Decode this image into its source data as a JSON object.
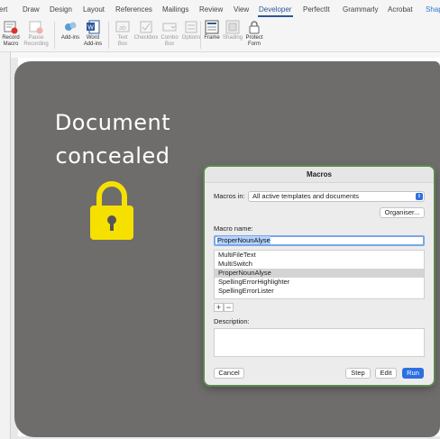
{
  "ribbon_tabs": [
    "ert",
    "Draw",
    "Design",
    "Layout",
    "References",
    "Mailings",
    "Review",
    "View",
    "Developer",
    "PerfectIt",
    "Grammarly",
    "Acrobat",
    "Shap"
  ],
  "active_tab": "Developer",
  "toolbar": {
    "record_macro": "Record\nMacro",
    "pause_recording": "Pause\nRecording",
    "add_ins": "Add-ins",
    "word_add_ins": "Word\nAdd-ins",
    "text_box": "Text\nBox",
    "checkbox": "Checkbox",
    "combo_box": "Combo\nBox",
    "options": "Options",
    "frame": "Frame",
    "shading": "Shading",
    "protect_form": "Protect\nForm"
  },
  "document": {
    "overlay_line1": "Document",
    "overlay_line2": "concealed",
    "icon": "padlock-icon",
    "lock_color": "#f5e000",
    "overlay_color": "#6f6c6c"
  },
  "macros_dialog": {
    "title": "Macros",
    "macros_in_label": "Macros in:",
    "macros_in_value": "All active templates and documents",
    "organiser_button": "Organiser...",
    "macro_name_label": "Macro name:",
    "macro_name_value": "ProperNounAlyse",
    "macro_list": [
      "MultiFileText",
      "MultiSwitch",
      "ProperNounAlyse",
      "SpellingErrorHighlighter",
      "SpellingErrorLister"
    ],
    "selected_macro": "ProperNounAlyse",
    "add_button": "+",
    "remove_button": "−",
    "description_label": "Description:",
    "description_value": "",
    "cancel_button": "Cancel",
    "step_button": "Step",
    "edit_button": "Edit",
    "run_button": "Run",
    "accent_color": "#2d6fe0"
  }
}
